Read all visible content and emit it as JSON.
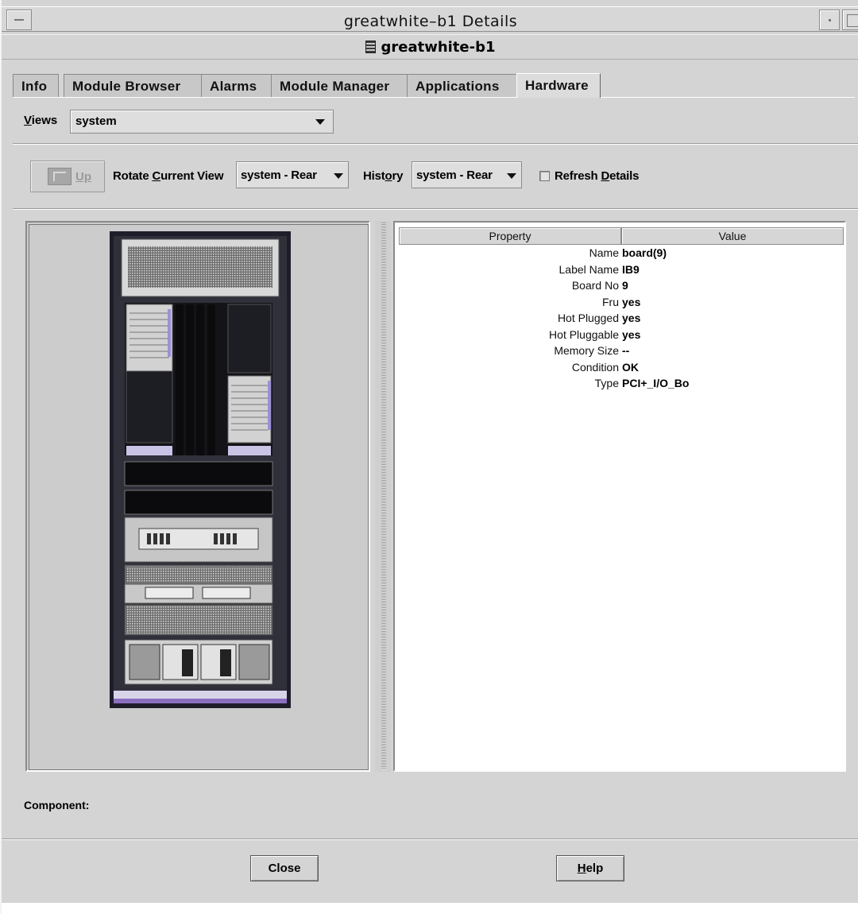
{
  "window": {
    "title": "greatwhite–b1 Details"
  },
  "header": {
    "host_name": "greatwhite-b1"
  },
  "tabs": [
    {
      "label": "Info"
    },
    {
      "label": "Module Browser"
    },
    {
      "label": "Alarms"
    },
    {
      "label": "Module Manager"
    },
    {
      "label": "Applications"
    },
    {
      "label": "Hardware",
      "active": true
    }
  ],
  "views": {
    "label_mnemonic": "V",
    "label_rest": "iews",
    "selected": "system"
  },
  "toolbar": {
    "up_label": "Up",
    "rotate_label_a": "Rotate ",
    "rotate_label_mnemonic": "C",
    "rotate_label_b": "urrent View",
    "rotate_selected": "system - Rear",
    "history_label_a": "Hist",
    "history_label_mnemonic": "o",
    "history_label_b": "ry",
    "history_selected": "system - Rear",
    "refresh_label_a": "Refresh ",
    "refresh_label_mnemonic": "D",
    "refresh_label_b": "etails",
    "refresh_checked": false
  },
  "property_table": {
    "columns": [
      "Property",
      "Value"
    ],
    "rows": [
      {
        "name": "Name",
        "value": "board(9)"
      },
      {
        "name": "Label Name",
        "value": "IB9"
      },
      {
        "name": "Board No",
        "value": "9"
      },
      {
        "name": "Fru",
        "value": "yes"
      },
      {
        "name": "Hot Plugged",
        "value": "yes"
      },
      {
        "name": "Hot Pluggable",
        "value": "yes"
      },
      {
        "name": "Memory Size",
        "value": "--"
      },
      {
        "name": "Condition",
        "value": "OK"
      },
      {
        "name": "Type",
        "value": "PCI+_I/O_Bo"
      }
    ]
  },
  "component": {
    "label": "Component:"
  },
  "buttons": {
    "close": "Close",
    "help_mnemonic": "H",
    "help_rest": "elp"
  },
  "colors": {
    "window_bg": "#d4d4d4",
    "rack_frame": "#1e1e2a",
    "accent_purple": "#8a6fc0"
  },
  "icons": [
    "host-icon",
    "up-folder-icon",
    "dropdown-caret-icon",
    "rack-image"
  ]
}
